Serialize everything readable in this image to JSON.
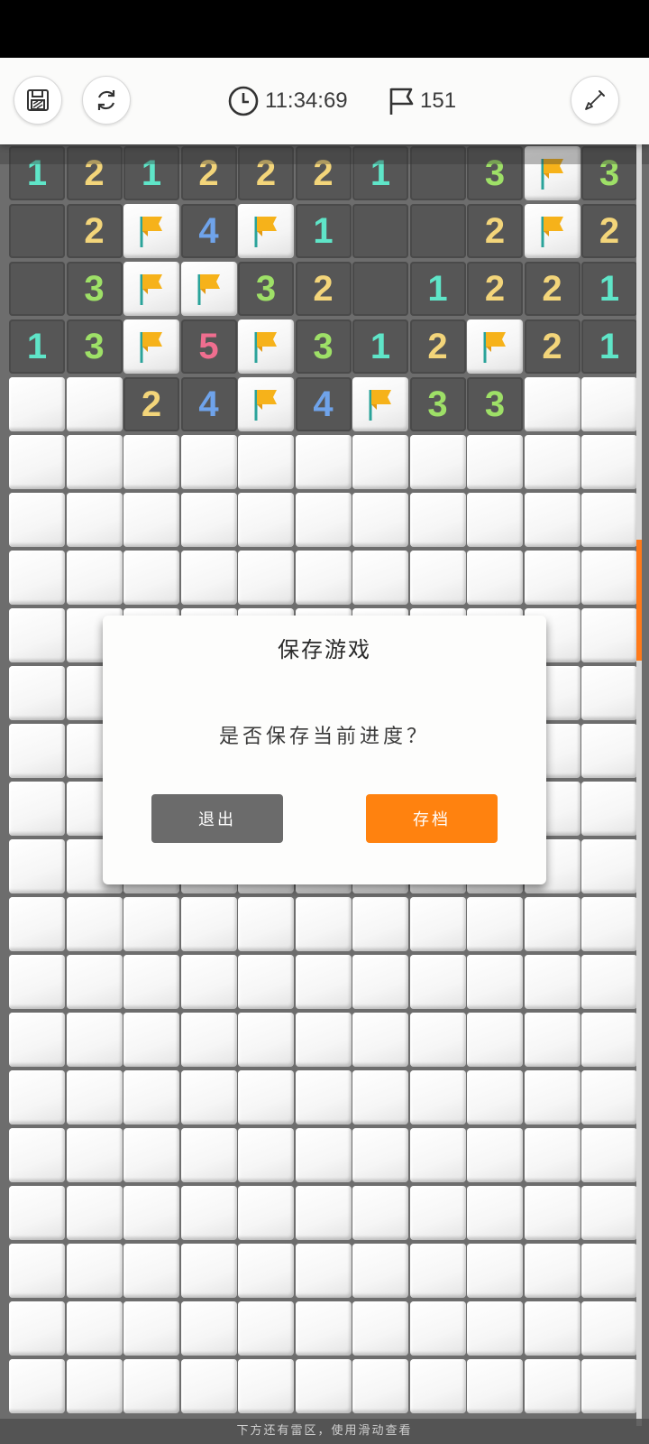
{
  "toolbar": {
    "save_icon": "save-icon",
    "restart_icon": "restart-icon",
    "timer_icon": "clock-icon",
    "timer": "11:34:69",
    "flag_icon": "flag-outline-icon",
    "flags_remaining": "151",
    "shovel_icon": "shovel-icon"
  },
  "board": {
    "columns": 11,
    "rows_visible": 22,
    "legend": "numbers = open cell with count, F = flag, . = empty open cell, # = closed cell",
    "rows": [
      [
        "1",
        "2",
        "1",
        "2",
        "2",
        "2",
        "1",
        ".",
        "3",
        "F",
        "3"
      ],
      [
        ".",
        "2",
        "F",
        "4",
        "F",
        "1",
        ".",
        ".",
        "2",
        "F",
        "2"
      ],
      [
        ".",
        "3",
        "F",
        "F",
        "3",
        "2",
        ".",
        "1",
        "2",
        "2",
        "1"
      ],
      [
        "1",
        "3",
        "F",
        "5",
        "F",
        "3",
        "1",
        "2",
        "F",
        "2",
        "1"
      ],
      [
        "#",
        "#",
        "2",
        "4",
        "F",
        "4",
        "F",
        "3",
        "3",
        "#",
        "#"
      ]
    ],
    "number_colors": {
      "1": "#5fe5c8",
      "2": "#f3d57a",
      "3": "#9ee067",
      "4": "#6fa3ea",
      "5": "#f06e8f"
    },
    "flag_color": "#f6b21a"
  },
  "dialog": {
    "title": "保存游戏",
    "message": "是否保存当前进度？",
    "exit_label": "退出",
    "save_label": "存档",
    "save_color": "#ff820f",
    "exit_color": "#6b6b6b"
  },
  "footer": {
    "hint": "下方还有雷区，使用滑动查看"
  }
}
